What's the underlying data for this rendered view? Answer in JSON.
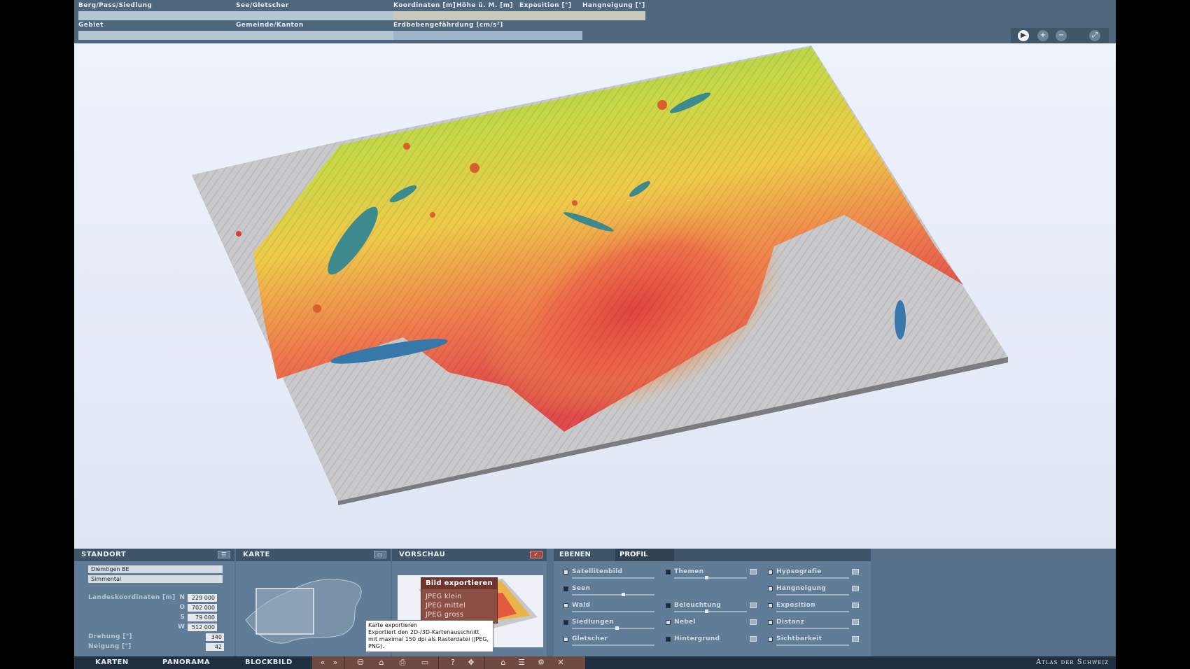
{
  "topbar": {
    "berg_label": "Berg/Pass/Siedlung",
    "see_label": "See/Gletscher",
    "koord_label": "Koordinaten [m]",
    "hoehe_label": "Höhe ü. M. [m]",
    "exposition_label": "Exposition [°]",
    "hangneigung_label": "Hangneigung [°]",
    "gebiet_label": "Gebiet",
    "gemeinde_label": "Gemeinde/Kanton",
    "erdbeben_label": "Erdbebengefährdung [cm/s²]"
  },
  "nav": {
    "play_icon": "play-icon",
    "zoom_in_icon": "zoom-in-icon",
    "zoom_out_icon": "zoom-out-icon",
    "fullscreen_icon": "fullscreen-icon"
  },
  "standort": {
    "title": "STANDORT",
    "place": "Diemtigen  BE",
    "region": "Simmental",
    "coords_label": "Landeskoordinaten [m]",
    "n_letter": "N",
    "n_value": "229 000",
    "o_letter": "O",
    "o_value": "702 000",
    "s_letter": "S",
    "s_value": "79 000",
    "w_letter": "W",
    "w_value": "512 000",
    "drehung_label": "Drehung [°]",
    "drehung_value": "340",
    "neigung_label": "Neigung [°]",
    "neigung_value": "42"
  },
  "karte": {
    "title": "KARTE"
  },
  "vorschau": {
    "title": "VORSCHAU"
  },
  "export_popup": {
    "title": "Bild exportieren",
    "items": [
      "JPEG klein",
      "JPEG mittel",
      "JPEG gross"
    ]
  },
  "tooltip": {
    "title": "Karte exportieren",
    "line1": "Exportiert den 2D-/3D-Kartenausschnitt",
    "line2": "mit maximal 150 dpi als Rasterdatei (JPEG,",
    "line3": "PNG)."
  },
  "layers_tabs": {
    "ebenen": "EBENEN",
    "profil": "PROFIL"
  },
  "layers": {
    "col1": [
      "Satellitenbild",
      "Seen",
      "Wald",
      "Siedlungen",
      "Gletscher"
    ],
    "col2": [
      "Themen",
      "Beleuchtung",
      "Nebel",
      "Hintergrund"
    ],
    "col3": [
      "Hypsografie",
      "Hangneigung",
      "Exposition",
      "Distanz",
      "Sichtbarkeit"
    ]
  },
  "footer": {
    "karten": "KARTEN",
    "panorama": "PANORAMA",
    "blockbild": "BLOCKBILD",
    "brand": "Atlas der Schweiz",
    "tools": [
      "«",
      "»",
      "⛁",
      "⌂",
      "⎙",
      "▭",
      "?",
      "✥",
      "⌂",
      "☰",
      "⚙",
      "✕"
    ]
  }
}
